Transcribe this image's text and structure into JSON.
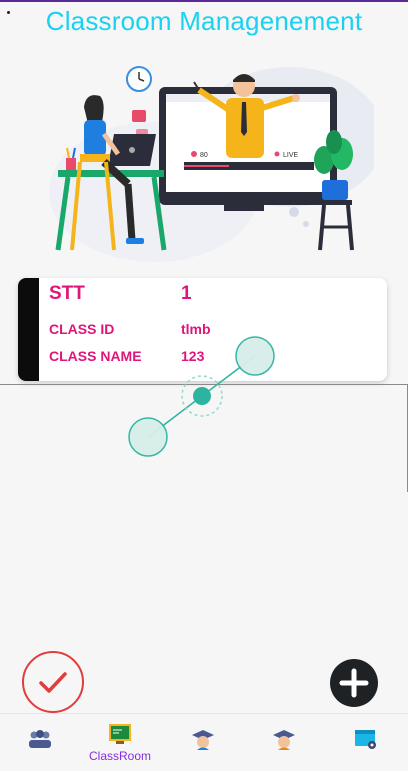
{
  "app": {
    "title": "Classroom Managenement"
  },
  "card": {
    "stt_label": "STT",
    "stt_value": "1",
    "class_id_label": "CLASS ID",
    "class_id_value": "tlmb",
    "class_name_label": "CLASS NAME",
    "class_name_value": "123"
  },
  "hero": {
    "viewer_count": "80",
    "live_label": "LIVE"
  },
  "actions": {
    "confirm_icon": "check-icon",
    "add_icon": "plus-icon"
  },
  "bottom_nav": {
    "items": [
      {
        "icon": "students-icon",
        "label": ""
      },
      {
        "icon": "classroom-board-icon",
        "label": "ClassRoom",
        "active": true
      },
      {
        "icon": "teacher-icon",
        "label": ""
      },
      {
        "icon": "graduate-icon",
        "label": ""
      },
      {
        "icon": "settings-window-icon",
        "label": ""
      }
    ]
  },
  "colors": {
    "title": "#18d2f0",
    "accent_pink": "#e0157a",
    "active_nav": "#8a2be2",
    "check_red": "#e23c3c",
    "fab": "#1f2225"
  }
}
